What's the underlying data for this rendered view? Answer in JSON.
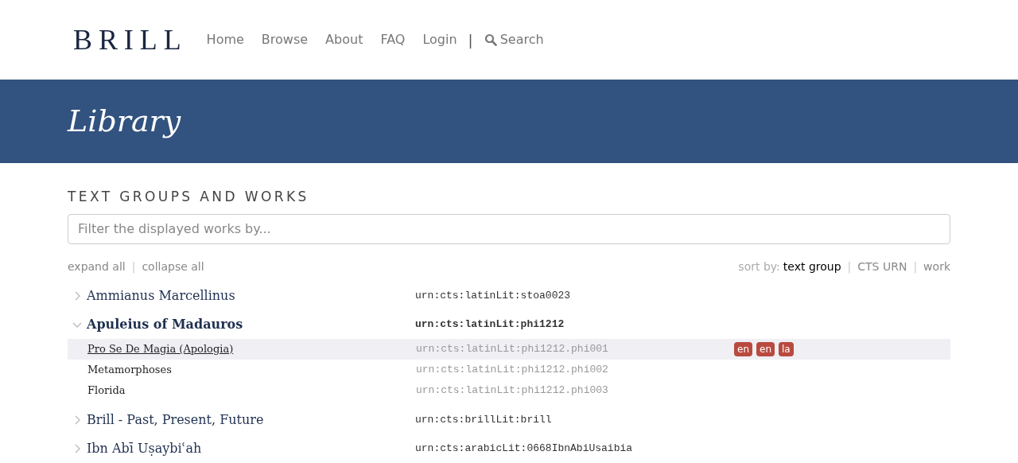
{
  "logo": "BRILL",
  "nav": [
    {
      "label": "Home"
    },
    {
      "label": "Browse"
    },
    {
      "label": "About"
    },
    {
      "label": "FAQ"
    },
    {
      "label": "Login"
    }
  ],
  "nav_separator": "|",
  "search_link": "Search",
  "banner_title": "Library",
  "section_heading": "TEXT GROUPS AND WORKS",
  "filter": {
    "placeholder": "Filter the displayed works by..."
  },
  "tree_controls": [
    "expand all",
    "collapse all"
  ],
  "tree_controls_separator": "|",
  "sort": {
    "label": "sort by:",
    "separator": "|",
    "options": [
      {
        "label": "text group",
        "selected": true
      },
      {
        "label": "CTS URN",
        "selected": false
      },
      {
        "label": "work",
        "selected": false
      }
    ]
  },
  "text_groups": [
    {
      "name": "Ammianus Marcellinus",
      "urn": "urn:cts:latinLit:stoa0023",
      "expanded": false
    },
    {
      "name": "Apuleius of Madauros",
      "urn": "urn:cts:latinLit:phi1212",
      "expanded": true,
      "works": [
        {
          "title": "Pro Se De Magia (Apologia)",
          "urn": "urn:cts:latinLit:phi1212.phi001",
          "highlighted": true,
          "languages": [
            "en",
            "en",
            "la"
          ]
        },
        {
          "title": "Metamorphoses",
          "urn": "urn:cts:latinLit:phi1212.phi002",
          "highlighted": false
        },
        {
          "title": "Florida",
          "urn": "urn:cts:latinLit:phi1212.phi003",
          "highlighted": false
        }
      ]
    },
    {
      "name": "Brill - Past, Present, Future",
      "urn": "urn:cts:brillLit:brill",
      "expanded": false
    },
    {
      "name": "Ibn Abī Uṣaybiʿah",
      "urn": "urn:cts:arabicLit:0668IbnAbiUsaibia",
      "expanded": false
    }
  ]
}
